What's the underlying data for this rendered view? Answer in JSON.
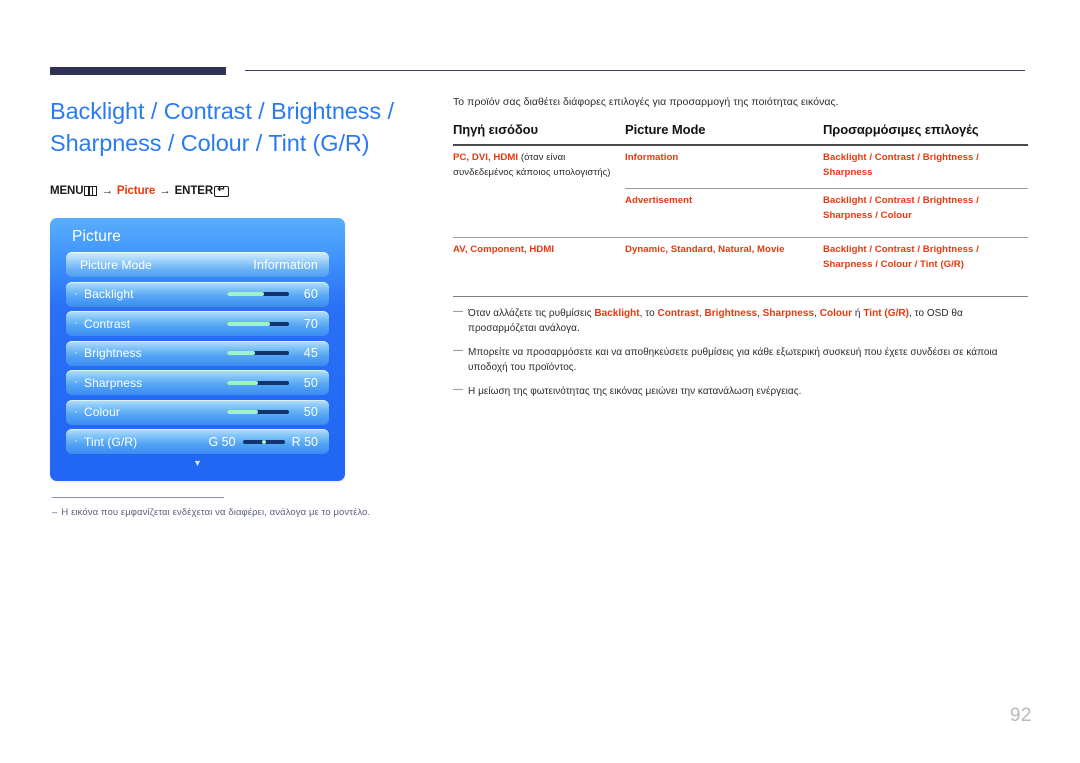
{
  "page": {
    "number": "92",
    "title": "Backlight / Contrast / Brightness / Sharpness / Colour / Tint (G/R)"
  },
  "menu_path": {
    "menu_label": "MENU",
    "menu_icon": "menu-bars-icon",
    "arrow1": "→",
    "picture_label": "Picture",
    "arrow2": "→",
    "enter_label": "ENTER",
    "enter_icon": "enter-return-icon",
    "enter_glyph": "↵"
  },
  "osd": {
    "title": "Picture",
    "rows": [
      {
        "label": "Picture Mode",
        "value": "Information",
        "type": "select",
        "bullet": ""
      },
      {
        "label": "Backlight",
        "value": "60",
        "type": "slider",
        "fill_pct": 60,
        "bullet": "·"
      },
      {
        "label": "Contrast",
        "value": "70",
        "type": "slider",
        "fill_pct": 70,
        "bullet": "·"
      },
      {
        "label": "Brightness",
        "value": "45",
        "type": "slider",
        "fill_pct": 45,
        "bullet": "·"
      },
      {
        "label": "Sharpness",
        "value": "50",
        "type": "slider",
        "fill_pct": 50,
        "bullet": "·"
      },
      {
        "label": "Colour",
        "value": "50",
        "type": "slider",
        "fill_pct": 50,
        "bullet": "·"
      },
      {
        "label": "Tint (G/R)",
        "type": "tint",
        "green_label": "G 50",
        "red_label": "R 50",
        "bullet": "·"
      }
    ],
    "scroll_more_icon": "chevron-down-icon",
    "scroll_more_glyph": "▼"
  },
  "left_note": {
    "dash": "–",
    "text": "Η εικόνα που εμφανίζεται ενδέχεται να διαφέρει, ανάλογα με το μοντέλο."
  },
  "right": {
    "intro": "Το προϊόν σας διαθέτει διάφορες επιλογές για προσαρμογή της ποιότητας εικόνας.",
    "table": {
      "headers": [
        "Πηγή εισόδου",
        "Picture Mode",
        "Προσαρμόσιμες επιλογές"
      ],
      "rows": [
        {
          "source_red": "PC, DVI, HDMI",
          "source_normal": " (όταν είναι συνδεδεμένος κάποιος υπολογιστής)",
          "mode": "Information",
          "options": "Backlight / Contrast / Brightness / Sharpness"
        },
        {
          "source_red": "",
          "source_normal": "",
          "mode": "Advertisement",
          "options": "Backlight / Contrast / Brightness / Sharpness / Colour"
        },
        {
          "source_red": "AV, Component, HDMI",
          "source_normal": "",
          "mode": "Dynamic, Standard, Natural, Movie",
          "options": "Backlight / Contrast / Brightness / Sharpness / Colour / Tint (G/R)"
        }
      ]
    },
    "notes": [
      {
        "dash": "—",
        "parts": [
          {
            "t": "Όταν αλλάζετε τις ρυθμίσεις ",
            "red": false
          },
          {
            "t": "Backlight",
            "red": true
          },
          {
            "t": ", το ",
            "red": false
          },
          {
            "t": "Contrast",
            "red": true
          },
          {
            "t": ", ",
            "red": false
          },
          {
            "t": "Brightness",
            "red": true
          },
          {
            "t": ", ",
            "red": false
          },
          {
            "t": "Sharpness",
            "red": true
          },
          {
            "t": ", ",
            "red": false
          },
          {
            "t": "Colour",
            "red": true
          },
          {
            "t": " ή ",
            "red": false
          },
          {
            "t": "Tint (G/R)",
            "red": true
          },
          {
            "t": ", το OSD θα προσαρμόζεται ανάλογα.",
            "red": false
          }
        ]
      },
      {
        "dash": "—",
        "parts": [
          {
            "t": "Μπορείτε να προσαρμόσετε και να αποθηκεύσετε ρυθμίσεις για κάθε εξωτερική συσκευή που έχετε συνδέσει σε κάποια υποδοχή του προϊόντος.",
            "red": false
          }
        ]
      },
      {
        "dash": "—",
        "parts": [
          {
            "t": "Η μείωση της φωτεινότητας της εικόνας μειώνει την κατανάλωση ενέργειας.",
            "red": false
          }
        ]
      }
    ]
  },
  "colors": {
    "title_blue": "#2a7bf2",
    "accent_red": "#e8380d",
    "header_navy": "#2e3257",
    "osd_blue": "#2166f4"
  }
}
